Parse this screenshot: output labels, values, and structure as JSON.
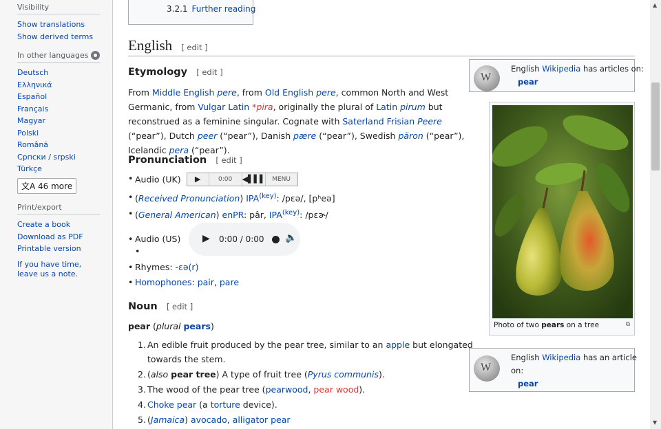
{
  "sidebar": {
    "visibility_header": "Visibility",
    "show_translations": "Show translations",
    "show_derived": "Show derived terms",
    "languages_header": "In other languages",
    "languages": [
      "Deutsch",
      "Ελληνικά",
      "Español",
      "Français",
      "Magyar",
      "Polski",
      "Română",
      "Српски / srpski",
      "Türkçe"
    ],
    "more_languages": "46 more",
    "print_header": "Print/export",
    "print_items": [
      "Create a book",
      "Download as PDF",
      "Printable version"
    ],
    "note_text": "If you have time, leave us a note."
  },
  "toc": {
    "num": "3.2.1",
    "label": "Further reading"
  },
  "english": {
    "heading": "English",
    "edit": "[ edit ]"
  },
  "etymology": {
    "heading": "Etymology",
    "edit": "[ edit ]",
    "text": {
      "from": "From",
      "middle_english": "Middle English",
      "pere1": "pere",
      "from2": ", from",
      "old_english": "Old English",
      "pere2": "pere",
      "rest1": ", common North and West Germanic, from",
      "vulgar_latin": "Vulgar Latin",
      "pira": "*pira",
      "rest2": ", originally the plural of",
      "latin": "Latin",
      "pirum": "pirum",
      "rest3": "but reconstrued as a feminine singular. Cognate with",
      "saterland": "Saterland Frisian",
      "peere": "Peere",
      "rest4": "(“pear”), Dutch",
      "peer": "peer",
      "rest5": "(“pear”), Danish",
      "paere": "pære",
      "rest6": "(“pear”), Swedish",
      "paron": "päron",
      "rest7": "(“pear”), Icelandic",
      "pera": "pera",
      "rest8": "(“pear”)."
    }
  },
  "pronunciation": {
    "heading": "Pronunciation",
    "edit": "[ edit ]",
    "audio_uk": "Audio (UK)",
    "player_time": "0:00",
    "player_menu": "MENU",
    "rp": {
      "open": "(",
      "label": "Received Pronunciation",
      "close": ")",
      "ipa": "IPA",
      "key": "(key)",
      "value": ": /pɛə/, [pʰeə]"
    },
    "ga": {
      "open": "(",
      "label": "General American",
      "close": ")",
      "enpr": "enPR",
      "enpr_value": ": pâr,",
      "ipa": "IPA",
      "key": "(key)",
      "value": ": /pɛɚ/"
    },
    "audio_us": "Audio (US)",
    "audio_us_time": "0:00 / 0:00",
    "rhymes_label": "Rhymes:",
    "rhymes_value": "-ɛə(r)",
    "homophones_label": "Homophones",
    "homophone1": "pair",
    "homophone2": "pare"
  },
  "noun": {
    "heading": "Noun",
    "edit": "[ edit ]",
    "headword": "pear",
    "plural_label": "plural",
    "plural": "pears",
    "definitions": {
      "d1a": "An edible fruit produced by the pear tree, similar to an",
      "d1link": "apple",
      "d1b": "but elongated",
      "d1c": "towards the stem.",
      "d2a": "(",
      "d2also": "also",
      "d2tree": "pear tree",
      "d2b": ") A type of fruit tree (",
      "d2link": "Pyrus communis",
      "d2c": ").",
      "d3a": "The wood of the pear tree (",
      "d3link1": "pearwood",
      "d3comma": ",",
      "d3link2": "pear wood",
      "d3b": ").",
      "d4link1": "Choke pear",
      "d4a": "(a",
      "d4link2": "torture",
      "d4b": "device).",
      "d5a": "(",
      "d5link1": "Jamaica",
      "d5b": ")",
      "d5link2": "avocado",
      "d5comma": ",",
      "d5link3": "alligator pear"
    },
    "numbers": [
      "1.",
      "2.",
      "3.",
      "4.",
      "5."
    ]
  },
  "wiki_box1": {
    "prefix": "English",
    "wikipedia": "Wikipedia",
    "suffix": "has articles on:",
    "link": "pear"
  },
  "wiki_box2": {
    "prefix": "English",
    "wikipedia": "Wikipedia",
    "suffix": "has an article",
    "suffix2": "on:",
    "link": "pear"
  },
  "image": {
    "caption_a": "Photo of two",
    "caption_bold": "pears",
    "caption_b": "on a tree"
  },
  "colors": {
    "link": "#0645ad",
    "redlink": "#d33",
    "sidebar_bg": "#f6f6f6"
  }
}
